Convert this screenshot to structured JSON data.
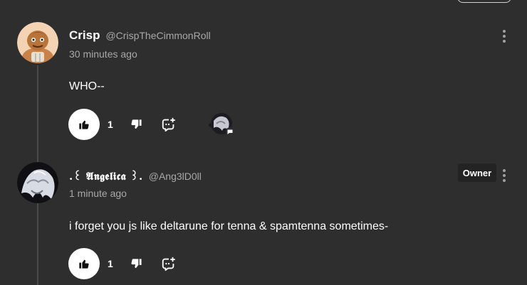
{
  "comments": [
    {
      "author": "Crisp",
      "handle": "@CrispTheCimmonRoll",
      "time": "30 minutes ago",
      "text": "WHO--",
      "likes": "1",
      "has_reply_preview": true,
      "owner": false
    },
    {
      "author": ".꒰ 𝕬𝖓𝖌𝖊𝖑𝖎𝖈𝖆 ꒱.",
      "handle": "@Ang3lD0ll",
      "time": "1 minute ago",
      "text": "i forget you js like deltarune for tenna & spamtenna  sometimes-",
      "likes": "1",
      "has_reply_preview": false,
      "owner": true,
      "owner_label": "Owner"
    }
  ],
  "icons": {
    "like": "thumbs-up-icon",
    "dislike": "thumbs-down-icon",
    "reply": "add-reply-icon",
    "more": "more-vertical-icon"
  },
  "colors": {
    "background": "#2e2e2e",
    "thread_line": "#4a4a4a",
    "secondary_text": "#a8a8a8",
    "badge_bg": "#232323"
  }
}
